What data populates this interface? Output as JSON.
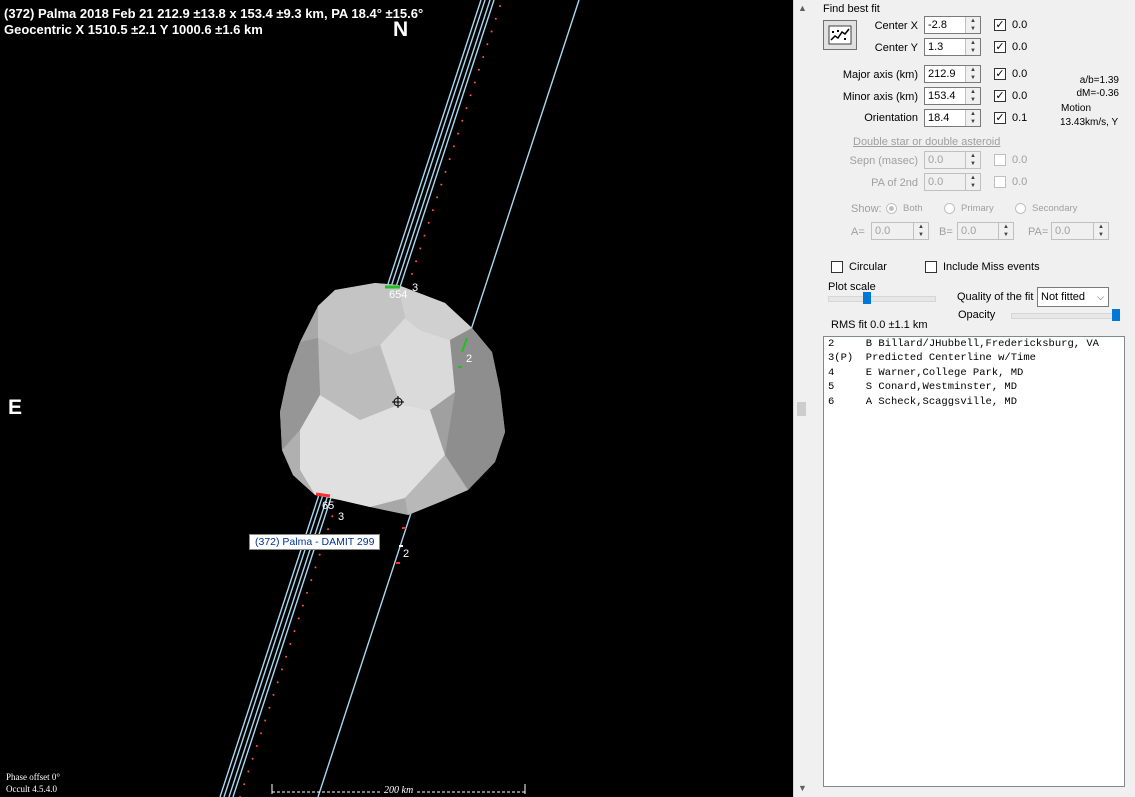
{
  "plot": {
    "title_line1": "(372) Palma  2018 Feb 21   212.9 ±13.8 x 153.4 ±9.3 km,  PA 18.4° ±15.6°",
    "title_line2": "Geocentric  X  1510.5 ±2.1  Y 1000.6 ±1.6 km",
    "north": "N",
    "east": "E",
    "shape_label": "(372) Palma - DAMIT 299",
    "chord_labels_top": [
      "654",
      "3",
      "2"
    ],
    "chord_labels_bottom": [
      "65",
      "3",
      "2"
    ],
    "scale_label": "200 km",
    "phase_offset": "Phase offset 0°",
    "version": "Occult 4.5.4.0",
    "colors": {
      "background": "#000000",
      "chord": "#a8d8f0",
      "predicted": "#ff4040",
      "asteroid": "#b8b8b8"
    }
  },
  "panel": {
    "find_best_fit": "Find best fit",
    "center_x_label": "Center X",
    "center_x": "-2.8",
    "center_x_check": "0.0",
    "center_y_label": "Center Y",
    "center_y": "1.3",
    "center_y_check": "0.0",
    "major_label": "Major axis (km)",
    "major": "212.9",
    "major_check": "0.0",
    "minor_label": "Minor axis (km)",
    "minor": "153.4",
    "minor_check": "0.0",
    "orient_label": "Orientation",
    "orient": "18.4",
    "orient_check": "0.1",
    "ab": "a/b=1.39",
    "dm": "dM=-0.36",
    "motion_label": "Motion",
    "motion": "13.43km/s, Y",
    "double_star": "Double star  or  double asteroid",
    "sepn_label": "Sepn (masec)",
    "sepn": "0.0",
    "sepn_check": "0.0",
    "pa2_label": "PA of 2nd",
    "pa2": "0.0",
    "pa2_check": "0.0",
    "show_label": "Show:",
    "radio_both": "Both",
    "radio_primary": "Primary",
    "radio_secondary": "Secondary",
    "a_label": "A=",
    "a_val": "0.0",
    "b_label": "B=",
    "b_val": "0.0",
    "pa_label": "PA=",
    "pa_val": "0.0",
    "circular": "Circular",
    "include_miss": "Include Miss events",
    "plot_scale": "Plot scale",
    "quality_label": "Quality of the fit",
    "quality": "Not fitted",
    "opacity": "Opacity",
    "rms": "RMS fit  0.0 ±1.1 km",
    "observers": [
      "2     B Billard/JHubbell,Fredericksburg, VA",
      "3(P)  Predicted Centerline w/Time",
      "4     E Warner,College Park, MD",
      "5     S Conard,Westminster, MD",
      "6     A Scheck,Scaggsville, MD"
    ]
  }
}
